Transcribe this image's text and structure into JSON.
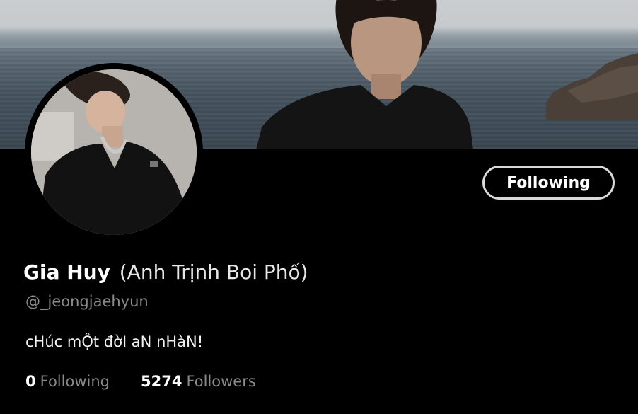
{
  "profile": {
    "display_name": "Gia Huy",
    "nickname": "(Anh Trịnh Boi Phố)",
    "handle": "@_jeongjaehyun",
    "bio": "cHúc mỘt đờI aN nHàN!"
  },
  "follow_button": {
    "label": "Following"
  },
  "stats": {
    "following_count": "0",
    "following_label": "Following",
    "followers_count": "5274",
    "followers_label": "Followers"
  },
  "images": {
    "banner": "header-photo-person-by-sea",
    "avatar": "profile-photo-person-in-black-shirt"
  },
  "colors": {
    "background": "#000000",
    "text_primary": "#ffffff",
    "text_muted": "#8a8a8a",
    "button_border": "#d9d9d9"
  }
}
